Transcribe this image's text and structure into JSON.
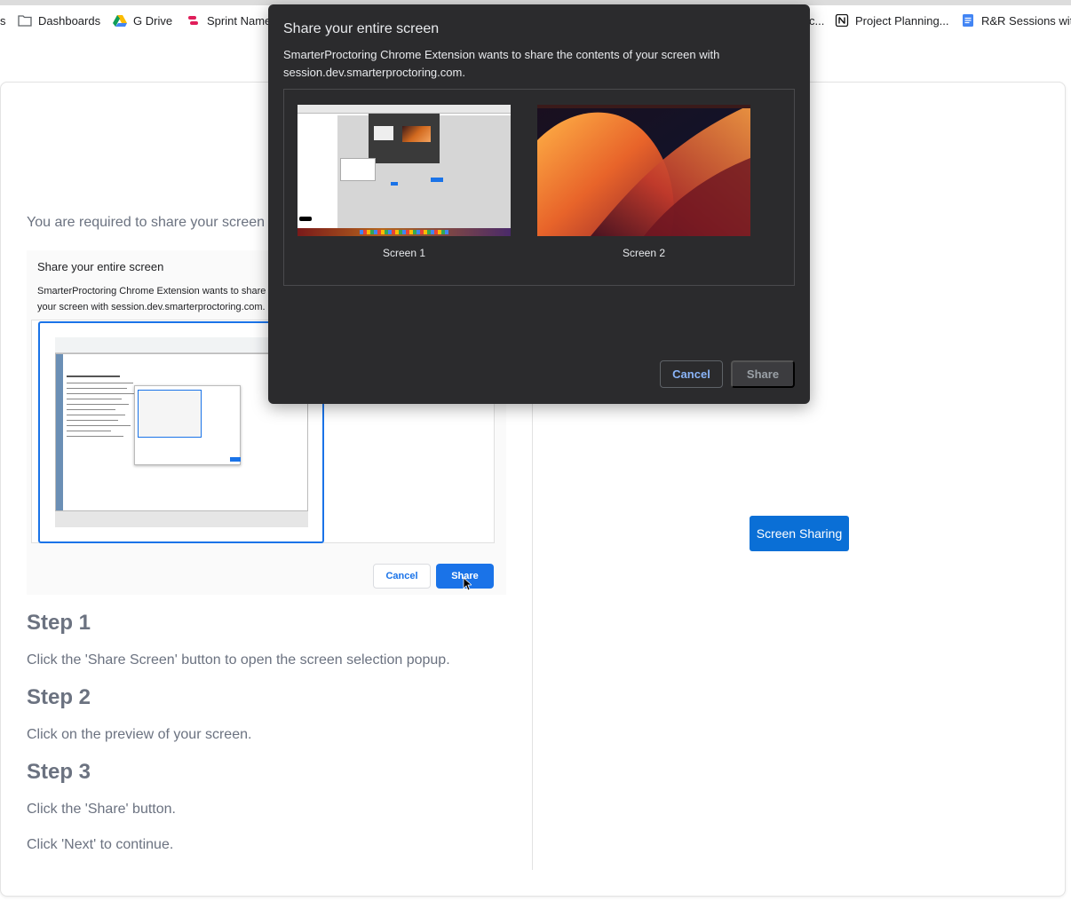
{
  "bookmarks": [
    {
      "label": "s",
      "icon": "none"
    },
    {
      "label": "Dashboards",
      "icon": "folder-icon"
    },
    {
      "label": "G Drive",
      "icon": "google-drive-icon"
    },
    {
      "label": "Sprint Name",
      "icon": "sprint-icon"
    },
    {
      "label": "c...",
      "icon": "none"
    },
    {
      "label": "Project Planning...",
      "icon": "notion-icon"
    },
    {
      "label": "R&R Sessions wit...",
      "icon": "google-docs-icon"
    }
  ],
  "page": {
    "required_text": "You are required to share your screen",
    "instruction_image": {
      "title": "Share your entire screen",
      "description": "SmarterProctoring Chrome Extension wants to share the contents of your screen with session.dev.smarterproctoring.com.",
      "cancel_label": "Cancel",
      "share_label": "Share"
    },
    "steps": [
      {
        "heading": "Step 1",
        "text": "Click the 'Share Screen' button to open the screen selection popup."
      },
      {
        "heading": "Step 2",
        "text": "Click on the preview of your screen."
      },
      {
        "heading": "Step 3",
        "text": "Click the 'Share' button."
      }
    ],
    "next_text": "Click 'Next' to continue.",
    "screen_sharing_button": "Screen Sharing"
  },
  "dialog": {
    "title": "Share your entire screen",
    "description": "SmarterProctoring Chrome Extension wants to share the contents of your screen with session.dev.smarterproctoring.com.",
    "screens": [
      {
        "label": "Screen 1"
      },
      {
        "label": "Screen 2"
      }
    ],
    "cancel_label": "Cancel",
    "share_label": "Share"
  },
  "colors": {
    "accent": "#1a73e8",
    "dialog_bg": "#2b2b2d",
    "screen_sharing_button": "#0a6fd6",
    "muted_text": "#6b7280"
  }
}
